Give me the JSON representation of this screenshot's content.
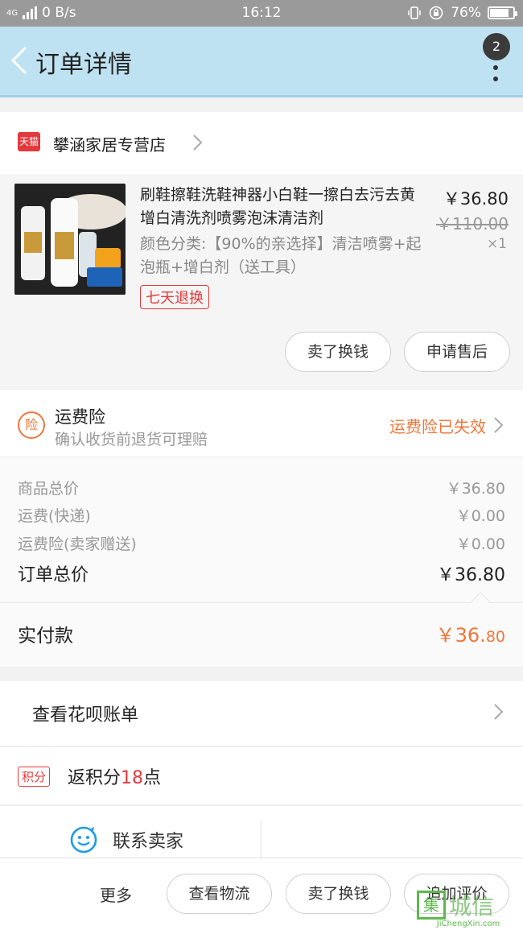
{
  "status_bar": {
    "network": "4G",
    "speed": "0 B/s",
    "time": "16:12",
    "battery": "76%"
  },
  "nav": {
    "title": "订单详情",
    "badge": "2"
  },
  "shop": {
    "badge": "天猫",
    "name": "攀涵家居专营店"
  },
  "goods": {
    "title": "刷鞋擦鞋洗鞋神器小白鞋一擦白去污去黄增白清洗剂喷雾泡沫清洁剂",
    "sku": "颜色分类:【90%的亲选择】清洁喷雾+起泡瓶+增白剂（送工具）",
    "tag": "七天退换",
    "price": "￥36.80",
    "original_price": "￥110.00",
    "quantity": "×1",
    "actions": [
      "卖了换钱",
      "申请售后"
    ]
  },
  "insurance": {
    "icon_text": "险",
    "title": "运费险",
    "subtitle": "确认收货前退货可理赔",
    "status": "运费险已失效"
  },
  "summary": {
    "rows": [
      {
        "label": "商品总价",
        "value": "￥36.80"
      },
      {
        "label": "运费(快递)",
        "value": "￥0.00"
      },
      {
        "label": "运费险(卖家赠送)",
        "value": "￥0.00"
      }
    ],
    "total_label": "订单总价",
    "total_value": "￥36.80"
  },
  "paid": {
    "label": "实付款",
    "value_main": "￥36.",
    "value_cents": "80"
  },
  "huabei": {
    "label": "查看花呗账单"
  },
  "points": {
    "tag": "积分",
    "prefix": "返积分",
    "number": "18",
    "suffix": "点"
  },
  "contact": {
    "label": "联系卖家"
  },
  "bottom_bar": {
    "more": "更多",
    "buttons": [
      "查看物流",
      "卖了换钱",
      "追加评价"
    ]
  },
  "watermark": {
    "chinese": "城信",
    "box_char": "集",
    "english": "JiChengXin.com"
  },
  "colors": {
    "accent_orange": "#f0763b",
    "tmall_red": "#e4393c",
    "nav_bg": "#bfe2f2",
    "status_bg": "#9a9a9a"
  }
}
